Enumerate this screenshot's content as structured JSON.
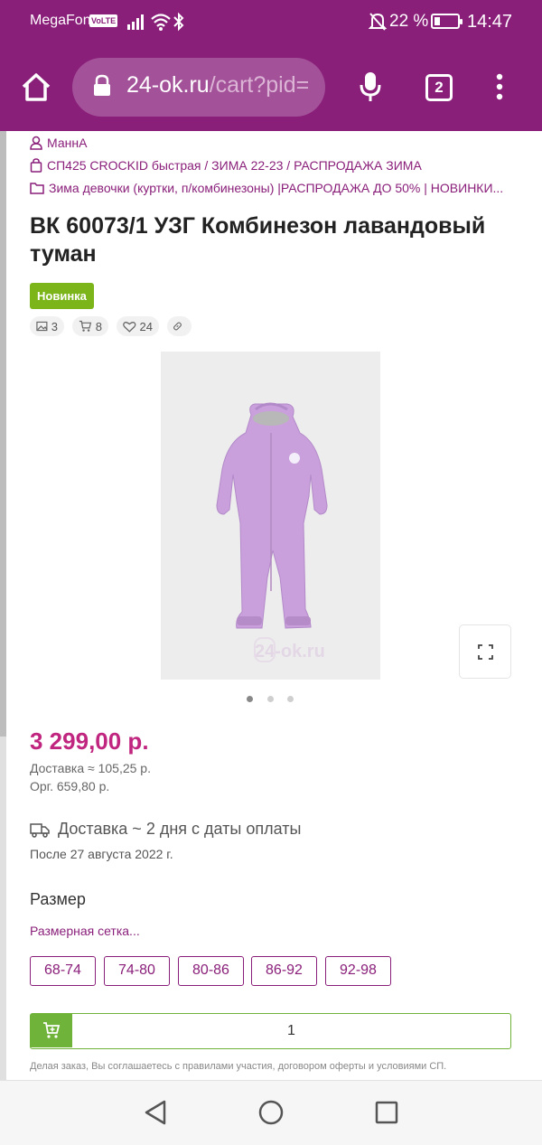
{
  "status_bar": {
    "carrier": "MegaFon",
    "volte": "VoLTE",
    "battery_percent": "22 %",
    "time": "14:47"
  },
  "browser": {
    "url_main": "24-ok.ru",
    "url_rest": "/cart?pid=",
    "tab_count": "2"
  },
  "breadcrumbs": {
    "user": "МаннА",
    "purchase": "СП425 CROCKID быстрая / ЗИМА 22-23 / РАСПРОДАЖА ЗИМА",
    "category": "Зима девочки (куртки, п/комбинезоны) |РАСПРОДАЖА ДО 50% | НОВИНКИ..."
  },
  "product": {
    "title": "ВК 60073/1 УЗГ Комбинезон лавандовый туман",
    "badge": "Новинка",
    "photos_count": "3",
    "cart_count": "8",
    "likes_count": "24",
    "watermark": "24-ok.ru",
    "price": "3 299,00 р.",
    "delivery_cost": "Доставка ≈ 105,25 р.",
    "org_fee": "Орг. 659,80 р.",
    "delivery_time": "Доставка ~ 2 дня с даты оплаты",
    "delivery_date": "После 27 августа 2022 г."
  },
  "size_section": {
    "label": "Размер",
    "size_chart_link": "Размерная сетка...",
    "sizes": [
      "68-74",
      "74-80",
      "80-86",
      "86-92",
      "92-98"
    ]
  },
  "cart": {
    "quantity": "1",
    "terms": "Делая заказ, Вы соглашаетесь с правилами участия, договором оферты и условиями СП."
  },
  "carousel": {
    "total": 3,
    "active": 1
  },
  "colors": {
    "brand": "#8a1f7a",
    "price": "#c0267f",
    "badge_green": "#7cb519",
    "cart_green": "#6fb33a",
    "garment": "#c9a0dc"
  }
}
